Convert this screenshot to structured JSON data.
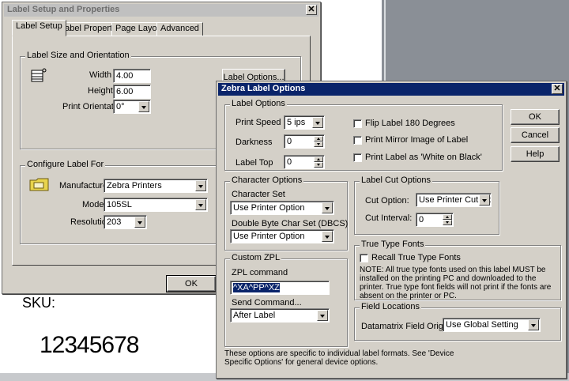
{
  "background": {
    "sku_label": "SKU:",
    "barcode_number": "12345678"
  },
  "label_setup_dialog": {
    "title": "Label Setup and Properties",
    "tabs": [
      "Label Setup",
      "Label Properties",
      "Page Layout",
      "Advanced"
    ],
    "size_group": {
      "legend": "Label Size and Orientation",
      "width_label": "Width",
      "width_value": "4.00",
      "height_label": "Height",
      "height_value": "6.00",
      "orientation_label": "Print Orientation",
      "orientation_value": "0°",
      "label_options_button": "Label Options..."
    },
    "configure_group": {
      "legend": "Configure Label For",
      "manufacturer_label": "Manufacturer",
      "manufacturer_value": "Zebra Printers",
      "model_label": "Model",
      "model_value": "105SL",
      "resolution_label": "Resolution",
      "resolution_value": "203"
    },
    "ok_button": "OK"
  },
  "zebra_dialog": {
    "title": "Zebra  Label Options",
    "label_options": {
      "legend": "Label Options",
      "print_speed_label": "Print Speed",
      "print_speed_value": "5 ips",
      "darkness_label": "Darkness",
      "darkness_value": "0",
      "label_top_label": "Label Top",
      "label_top_value": "0",
      "flip_label": "Flip Label 180 Degrees",
      "mirror_label": "Print Mirror Image of Label",
      "white_on_black_label": "Print Label as 'White on Black'"
    },
    "character_options": {
      "legend": "Character Options",
      "charset_label": "Character Set",
      "charset_value": "Use Printer Option",
      "dbcs_label": "Double Byte  Char Set (DBCS)",
      "dbcs_value": "Use Printer Option"
    },
    "label_cut_options": {
      "legend": "Label Cut Options",
      "cut_option_label": "Cut Option:",
      "cut_option_value": "Use Printer Cut Optic",
      "cut_interval_label": "Cut Interval:",
      "cut_interval_value": "0"
    },
    "true_type_fonts": {
      "legend": "True Type Fonts",
      "recall_label": "Recall True Type Fonts",
      "note": "NOTE:  All true type fonts used on this label MUST be installed on the printing PC and downloaded to the printer.  True type font fields will not print if the fonts are absent on the printer or PC."
    },
    "custom_zpl": {
      "legend": "Custom ZPL",
      "zpl_command_label": "ZPL command",
      "zpl_command_value": "^XA^PP^XZ",
      "send_command_label": "Send Command...",
      "send_command_value": "After Label"
    },
    "field_locations": {
      "legend": "Field Locations",
      "datamatrix_label": "Datamatrix Field Origins:",
      "datamatrix_value": "Use Global Setting"
    },
    "footer_note": "These options are specific to individual label formats. See 'Device Specific Options' for general device options.",
    "buttons": {
      "ok": "OK",
      "cancel": "Cancel",
      "help": "Help"
    }
  }
}
